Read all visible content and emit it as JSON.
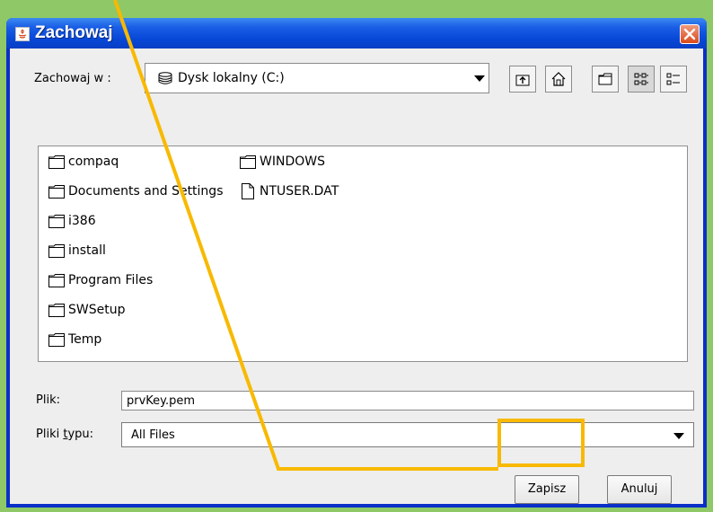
{
  "window": {
    "title": "Zachowaj"
  },
  "lookin": {
    "label": "Zachowaj w :",
    "value": "Dysk lokalny (C:)"
  },
  "toolbar": [
    {
      "name": "up-folder-button",
      "icon": "up-folder-icon"
    },
    {
      "name": "home-button",
      "icon": "home-icon"
    },
    {
      "name": "new-folder-button",
      "icon": "new-folder-icon"
    },
    {
      "name": "list-view-button",
      "icon": "list-view-icon"
    },
    {
      "name": "details-view-button",
      "icon": "details-view-icon"
    }
  ],
  "files": [
    {
      "name": "compaq",
      "type": "folder"
    },
    {
      "name": "Documents and Settings",
      "type": "folder"
    },
    {
      "name": "i386",
      "type": "folder"
    },
    {
      "name": "install",
      "type": "folder"
    },
    {
      "name": "Program Files",
      "type": "folder"
    },
    {
      "name": "SWSetup",
      "type": "folder"
    },
    {
      "name": "Temp",
      "type": "folder"
    },
    {
      "name": "WINDOWS",
      "type": "folder"
    },
    {
      "name": "NTUSER.DAT",
      "type": "file"
    }
  ],
  "filename": {
    "label": "Plik:",
    "value": "prvKey.pem"
  },
  "filetype": {
    "label_pre": "Pliki ",
    "label_mnemonic": "t",
    "label_post": "ypu:",
    "value": "All Files"
  },
  "buttons": {
    "save": "Zapisz",
    "cancel": "Anuluj"
  },
  "annotation": {
    "color": "#f8b900"
  }
}
